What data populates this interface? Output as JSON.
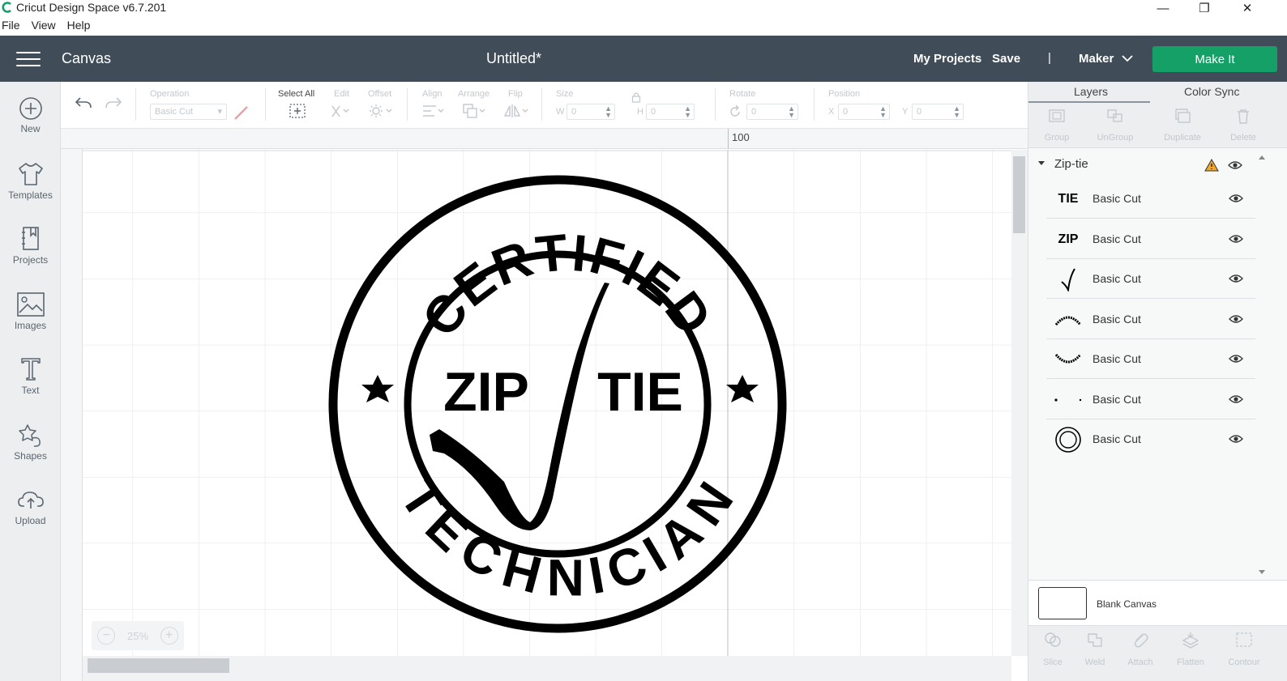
{
  "window": {
    "title": "Cricut Design Space  v6.7.201",
    "menu": [
      "File",
      "View",
      "Help"
    ],
    "minimize_glyph": "—",
    "maximize_glyph": "❐",
    "close_glyph": "✕"
  },
  "header": {
    "section": "Canvas",
    "document_title": "Untitled*",
    "my_projects": "My Projects",
    "save": "Save",
    "separator": "|",
    "machine": "Maker",
    "make_it": "Make It",
    "make_it_color": "#14a067",
    "background": "#404d59"
  },
  "sidebar": {
    "items": [
      {
        "label": "New",
        "icon": "plus-circle-icon"
      },
      {
        "label": "Templates",
        "icon": "tshirt-icon"
      },
      {
        "label": "Projects",
        "icon": "projects-icon"
      },
      {
        "label": "Images",
        "icon": "image-icon"
      },
      {
        "label": "Text",
        "icon": "text-icon"
      },
      {
        "label": "Shapes",
        "icon": "shapes-icon"
      },
      {
        "label": "Upload",
        "icon": "cloud-upload-icon"
      }
    ]
  },
  "toolbar": {
    "operation_label": "Operation",
    "operation_value": "Basic Cut",
    "select_all": "Select All",
    "edit": "Edit",
    "offset": "Offset",
    "align": "Align",
    "arrange": "Arrange",
    "flip": "Flip",
    "size": "Size",
    "size_w_label": "W",
    "size_w_value": "0",
    "size_h_label": "H",
    "size_h_value": "0",
    "rotate": "Rotate",
    "rotate_value": "0",
    "position": "Position",
    "pos_x_label": "X",
    "pos_x_value": "0",
    "pos_y_label": "Y",
    "pos_y_value": "0"
  },
  "canvas": {
    "ruler_label": "100",
    "zoom": "25%",
    "zoom_minus": "−",
    "zoom_plus": "+",
    "design": {
      "top_text": "CERTIFIED",
      "bottom_text": "TECHNICIAN",
      "center_left": "ZIP",
      "center_right": "TIE"
    }
  },
  "layers_panel": {
    "tabs": [
      "Layers",
      "Color Sync"
    ],
    "actions": [
      "Group",
      "UnGroup",
      "Duplicate",
      "Delete"
    ],
    "group_name": "Zip-tie",
    "warning_color": "#f5a623",
    "layers": [
      {
        "thumb_text": "TIE",
        "operation": "Basic Cut",
        "thumb": "tie-text"
      },
      {
        "thumb_text": "ZIP",
        "operation": "Basic Cut",
        "thumb": "zip-text"
      },
      {
        "thumb_text": "",
        "operation": "Basic Cut",
        "thumb": "checkmark"
      },
      {
        "thumb_text": "",
        "operation": "Basic Cut",
        "thumb": "certified-arc"
      },
      {
        "thumb_text": "",
        "operation": "Basic Cut",
        "thumb": "technician-arc"
      },
      {
        "thumb_text": "",
        "operation": "Basic Cut",
        "thumb": "stars"
      },
      {
        "thumb_text": "",
        "operation": "Basic Cut",
        "thumb": "rings"
      }
    ],
    "blank_canvas": "Blank Canvas",
    "bottom_actions": [
      "Slice",
      "Weld",
      "Attach",
      "Flatten",
      "Contour"
    ]
  }
}
